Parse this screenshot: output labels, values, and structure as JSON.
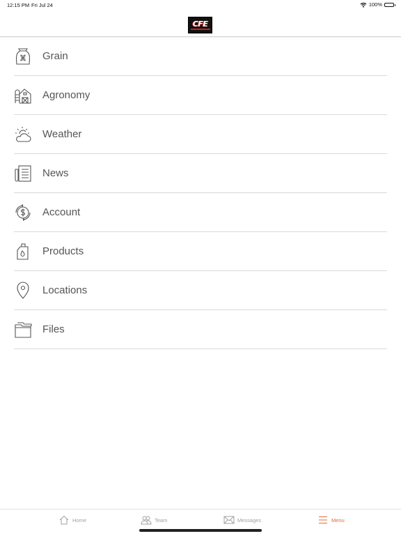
{
  "status_bar": {
    "time": "12:15 PM",
    "date": "Fri Jul 24",
    "battery": "100%",
    "icons": [
      "wifi-icon",
      "battery-icon"
    ]
  },
  "header": {
    "logo_text": "CFE",
    "logo_colors": {
      "background": "#111111",
      "accent": "#c41e1e"
    }
  },
  "menu": {
    "items": [
      {
        "label": "Grain",
        "icon": "grain-bag-icon"
      },
      {
        "label": "Agronomy",
        "icon": "barn-icon"
      },
      {
        "label": "Weather",
        "icon": "sun-cloud-icon"
      },
      {
        "label": "News",
        "icon": "newspaper-icon"
      },
      {
        "label": "Account",
        "icon": "dollar-circle-icon"
      },
      {
        "label": "Products",
        "icon": "jug-icon"
      },
      {
        "label": "Locations",
        "icon": "map-pin-icon"
      },
      {
        "label": "Files",
        "icon": "folder-icon"
      }
    ]
  },
  "tab_bar": {
    "active_color": "#e46a3a",
    "inactive_color": "#a0a0a0",
    "tabs": [
      {
        "label": "Home",
        "icon": "home-icon",
        "active": false
      },
      {
        "label": "Team",
        "icon": "team-icon",
        "active": false
      },
      {
        "label": "Messages",
        "icon": "envelope-icon",
        "active": false
      },
      {
        "label": "Menu",
        "icon": "hamburger-icon",
        "active": true
      }
    ]
  }
}
